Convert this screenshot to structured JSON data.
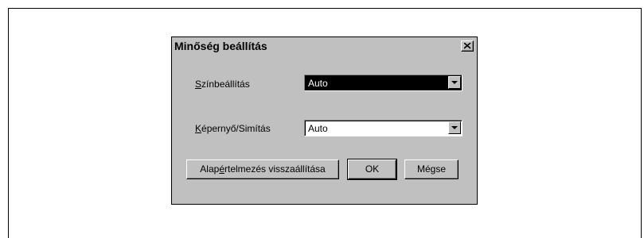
{
  "dialog": {
    "title": "Minőség beállítás",
    "color_setting": {
      "label": "Színbeállítás",
      "value": "Auto"
    },
    "screen_smoothing": {
      "label": "Képernyő/Simítás",
      "value": "Auto"
    },
    "buttons": {
      "reset": "Alapértelmezés visszaállítása",
      "ok": "OK",
      "cancel": "Mégse"
    }
  }
}
